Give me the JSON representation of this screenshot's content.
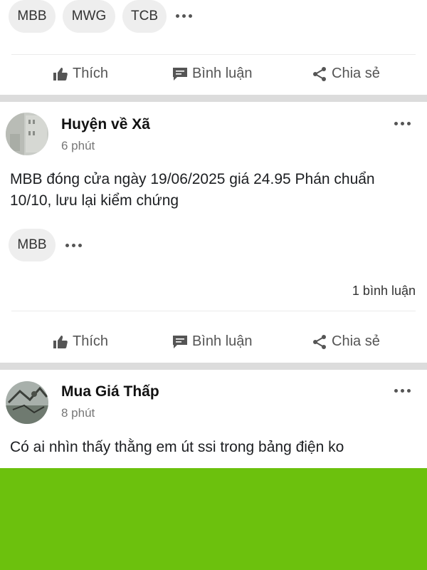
{
  "top_tags": [
    "MBB",
    "MWG",
    "TCB"
  ],
  "actions": {
    "like": "Thích",
    "comment": "Bình luận",
    "share": "Chia sẻ"
  },
  "posts": [
    {
      "author": "Huyện về Xã",
      "time": "6 phút",
      "text": "MBB đóng cửa ngày 19/06/2025 giá 24.95 Phán chuẩn 10/10, lưu lại kiểm chứng",
      "tags": [
        "MBB"
      ],
      "comment_count": "1 bình luận"
    },
    {
      "author": "Mua Giá Thấp",
      "time": "8 phút",
      "text": "Có ai nhìn thấy thằng em út ssi trong bảng điện ko"
    }
  ],
  "colors": {
    "chip_bg": "#eeeeee",
    "divider_band": "#dcdcdc",
    "green_banner": "#6cc10d"
  }
}
